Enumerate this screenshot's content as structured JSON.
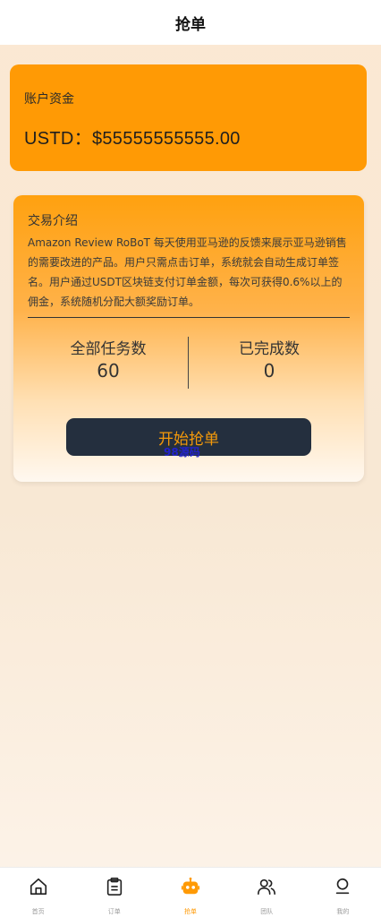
{
  "header": {
    "title": "抢单"
  },
  "fund": {
    "label": "账户资金",
    "amount": "USTD：$55555555555.00"
  },
  "intro": {
    "title": "交易介绍",
    "description": "Amazon Review RoBoT 每天使用亚马逊的反馈来展示亚马逊销售的需要改进的产品。用户只需点击订单，系统就会自动生成订单签名。用户通过USDT区块链支付订单金额，每次可获得0.6%以上的佣金，系统随机分配大额奖励订单。"
  },
  "stats": {
    "total_label": "全部任务数",
    "total_value": "60",
    "done_label": "已完成数",
    "done_value": "0"
  },
  "action": {
    "start_label": "开始抢单",
    "watermark": "98源码"
  },
  "colors": {
    "accent": "#ff9a05",
    "button_bg": "#242f3e"
  },
  "tabbar": {
    "items": [
      {
        "label": "首页",
        "icon": "home-icon"
      },
      {
        "label": "订单",
        "icon": "clipboard-icon"
      },
      {
        "label": "抢单",
        "icon": "robot-icon",
        "active": true
      },
      {
        "label": "团队",
        "icon": "team-icon"
      },
      {
        "label": "我的",
        "icon": "user-icon"
      }
    ]
  }
}
